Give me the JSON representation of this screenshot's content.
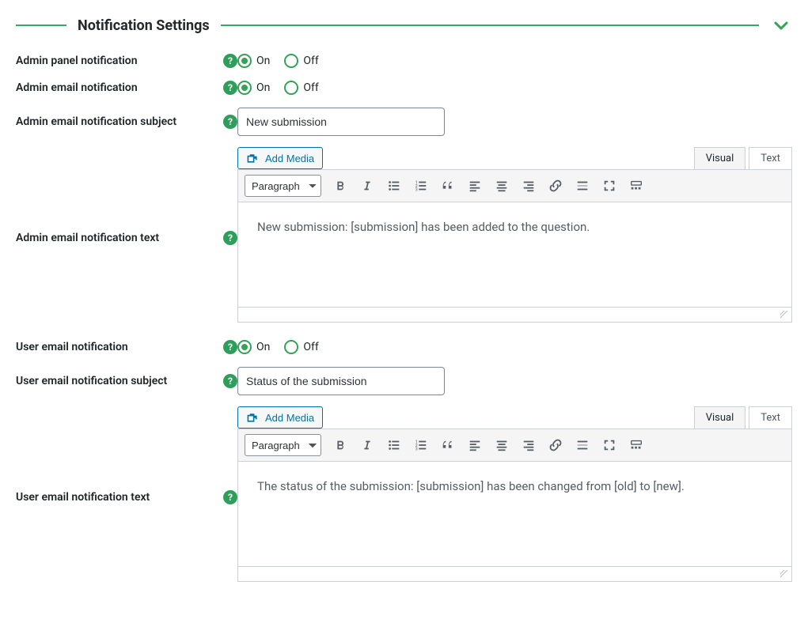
{
  "section": {
    "title": "Notification Settings",
    "collapse_icon": "chevron-down"
  },
  "rows": {
    "admin_panel": {
      "label": "Admin panel notification",
      "on": "On",
      "off": "Off",
      "value": "on"
    },
    "admin_email": {
      "label": "Admin email notification",
      "on": "On",
      "off": "Off",
      "value": "on"
    },
    "admin_subject": {
      "label": "Admin email notification subject",
      "value": "New submission"
    },
    "admin_text": {
      "label": "Admin email notification text"
    },
    "user_email": {
      "label": "User email notification",
      "on": "On",
      "off": "Off",
      "value": "on"
    },
    "user_subject": {
      "label": "User email notification subject",
      "value": "Status of the submission"
    },
    "user_text": {
      "label": "User email notification text"
    }
  },
  "editor": {
    "add_media": "Add Media",
    "tab_visual": "Visual",
    "tab_text": "Text",
    "format_option": "Paragraph",
    "admin_body": "New submission: [submission] has been added to the question.",
    "user_body": "The status of the submission: [submission] has been changed from [old] to [new]."
  },
  "help_glyph": "?"
}
